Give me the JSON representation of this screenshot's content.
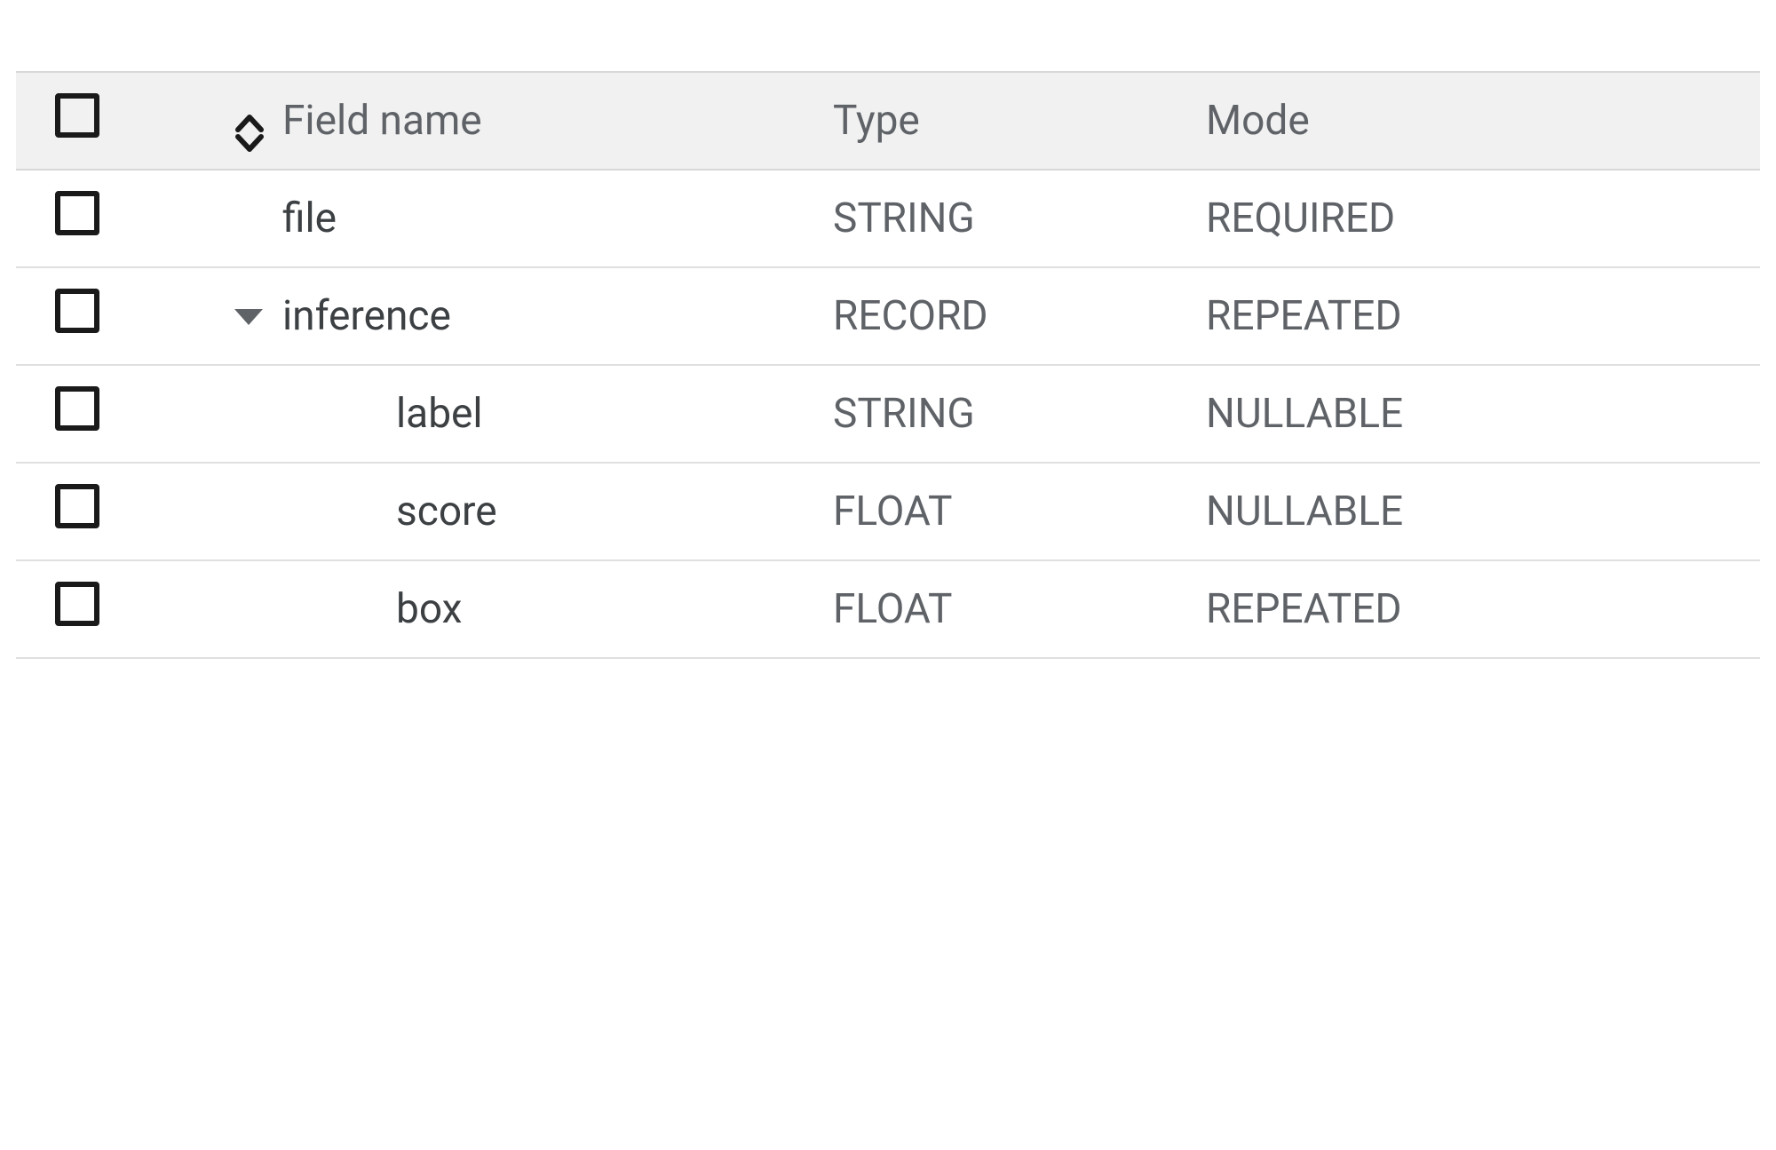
{
  "table": {
    "headers": {
      "field_name": "Field name",
      "type": "Type",
      "mode": "Mode"
    },
    "rows": [
      {
        "name": "file",
        "type": "STRING",
        "mode": "REQUIRED",
        "indent": 1,
        "expandable": false,
        "expanded": false
      },
      {
        "name": "inference",
        "type": "RECORD",
        "mode": "REPEATED",
        "indent": 1,
        "expandable": true,
        "expanded": true
      },
      {
        "name": "label",
        "type": "STRING",
        "mode": "NULLABLE",
        "indent": 2,
        "expandable": false,
        "expanded": false
      },
      {
        "name": "score",
        "type": "FLOAT",
        "mode": "NULLABLE",
        "indent": 2,
        "expandable": false,
        "expanded": false
      },
      {
        "name": "box",
        "type": "FLOAT",
        "mode": "REPEATED",
        "indent": 2,
        "expandable": false,
        "expanded": false
      }
    ]
  }
}
